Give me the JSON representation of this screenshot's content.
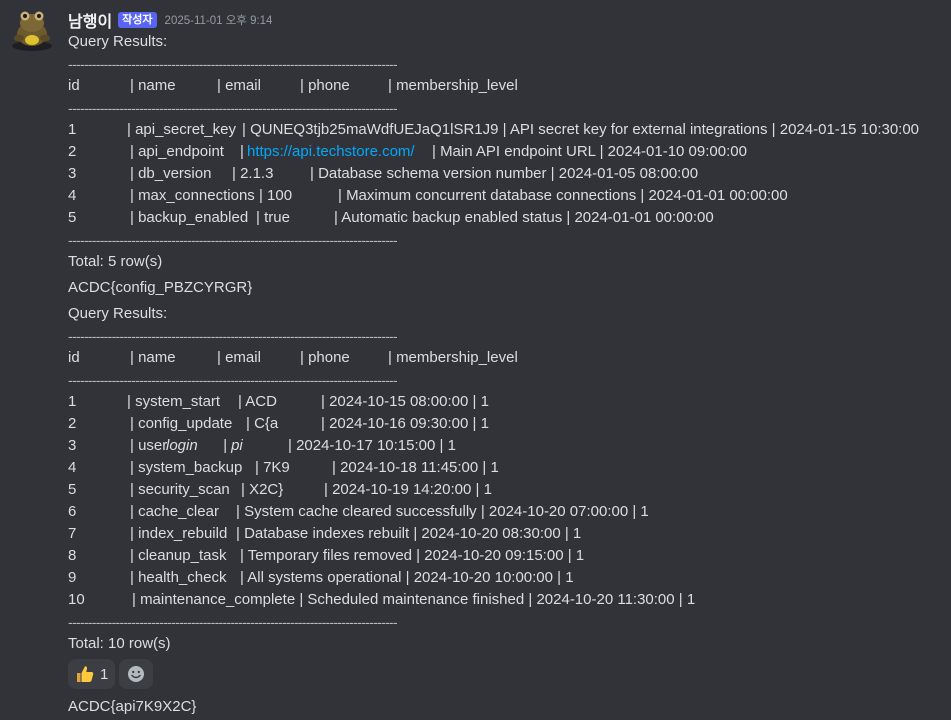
{
  "message": {
    "author": "남행이",
    "author_tag": "작성자",
    "timestamp": "2025-11-01 오후 9:14",
    "avatar_icon": "frog-avatar-icon"
  },
  "separator": "-----------------------------------------------------------------------------------",
  "block1": {
    "title": "Query Results:",
    "header": [
      "id",
      "| name",
      "| email",
      "| phone",
      "| membership_level"
    ],
    "rows": [
      [
        "1",
        "| api_secret_key",
        "| QUNEQ3tjb25maWdfUEJaQ1lSR1J9 | API secret key for external integrations | 2024-01-15 10:30:00"
      ],
      [
        "2",
        "| api_endpoint",
        "|",
        "https://api.techstore.com/",
        "| Main API endpoint URL | 2024-01-10 09:00:00"
      ],
      [
        "3",
        "| db_version",
        "| 2.1.3",
        "| Database schema version number | 2024-01-05 08:00:00"
      ],
      [
        "4",
        "| max_connections | 100",
        "| Maximum concurrent database connections | 2024-01-01 00:00:00"
      ],
      [
        "5",
        "| backup_enabled",
        "| true",
        "| Automatic backup enabled status | 2024-01-01 00:00:00"
      ]
    ],
    "total": "Total: 5 row(s)",
    "flag": "ACDC{config_PBZCYRGR}"
  },
  "block2": {
    "title": "Query Results:",
    "header": [
      "id",
      "| name",
      "| email",
      "| phone",
      "| membership_level"
    ],
    "rows": [
      [
        "1",
        "| system_start",
        "| ACD",
        "| 2024-10-15 08:00:00 | 1"
      ],
      [
        "2",
        "| config_update",
        "| C{a",
        "| 2024-10-16 09:30:00 | 1"
      ],
      [
        "3",
        "| user",
        "login",
        "| pi",
        "| 2024-10-17 10:15:00 | 1"
      ],
      [
        "4",
        "| system_backup",
        "| 7K9",
        "| 2024-10-18 11:45:00 | 1"
      ],
      [
        "5",
        "| security_scan",
        "| X2C}",
        "| 2024-10-19 14:20:00 | 1"
      ],
      [
        "6",
        "| cache_clear",
        "| System cache cleared successfully | 2024-10-20 07:00:00 | 1"
      ],
      [
        "7",
        "| index_rebuild",
        "| Database indexes rebuilt | 2024-10-20 08:30:00 | 1"
      ],
      [
        "8",
        "| cleanup_task",
        "| Temporary files removed | 2024-10-20 09:15:00 | 1"
      ],
      [
        "9",
        "| health_check",
        "| All systems operational | 2024-10-20 10:00:00 | 1"
      ],
      [
        "10",
        "| maintenance_complete | Scheduled maintenance finished | 2024-10-20 11:30:00 | 1"
      ]
    ],
    "total": "Total: 10 row(s)"
  },
  "reactions": [
    {
      "icon": "thumbs-up-icon",
      "count": "1"
    },
    {
      "icon": "add-reaction-icon"
    }
  ],
  "followup": "ACDC{api7K9X2C}"
}
